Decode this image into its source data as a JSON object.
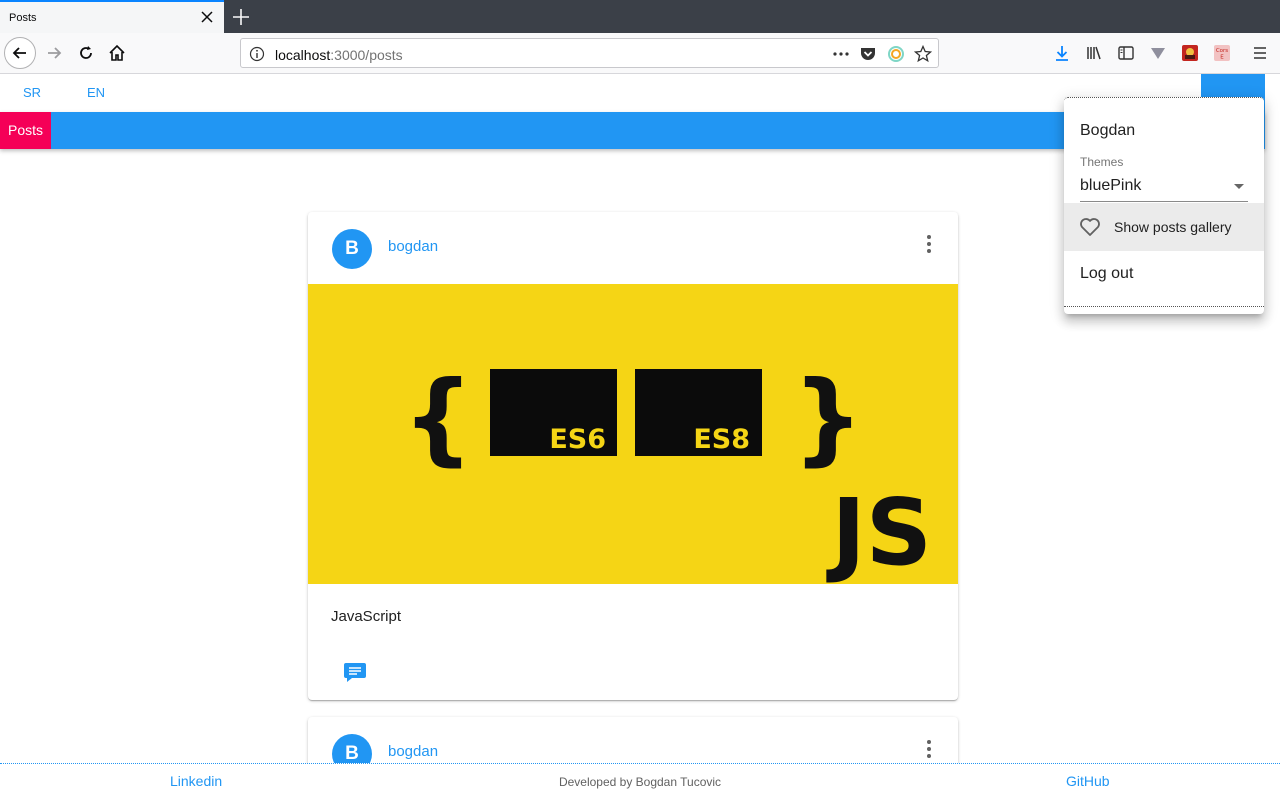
{
  "browser": {
    "tab_title": "Posts",
    "url_host": "localhost",
    "url_path": ":3000/posts",
    "icons": [
      "close-icon",
      "plus-icon",
      "back-icon",
      "forward-icon",
      "reload-icon",
      "home-icon",
      "info-icon",
      "more-icon",
      "pocket-icon",
      "extension-icon",
      "star-icon",
      "download-icon",
      "library-icon",
      "sidebar-icon",
      "vpn-icon",
      "extension-icon",
      "cors-icon",
      "hamburger-icon"
    ],
    "cors_label_1": "Cors",
    "cors_label_2": "E"
  },
  "header": {
    "languages": [
      "SR",
      "EN"
    ],
    "nav_tab": "Posts",
    "accent": "#2196f3",
    "secondary": "#f50057"
  },
  "posts": [
    {
      "avatar_letter": "B",
      "author": "bogdan",
      "title": "JavaScript",
      "image": {
        "background": "#f5d515",
        "left_brace": "{",
        "right_brace": "}",
        "box1": "ES6",
        "box2": "ES8",
        "logo": "JS"
      }
    },
    {
      "avatar_letter": "B",
      "author": "bogdan"
    }
  ],
  "menu": {
    "username": "Bogdan",
    "themes_label": "Themes",
    "theme_value": "bluePink",
    "gallery_label": "Show posts gallery",
    "logout_label": "Log out"
  },
  "footer": {
    "linkedin": "Linkedin",
    "credit": "Developed by Bogdan Tucovic",
    "github": "GitHub"
  }
}
